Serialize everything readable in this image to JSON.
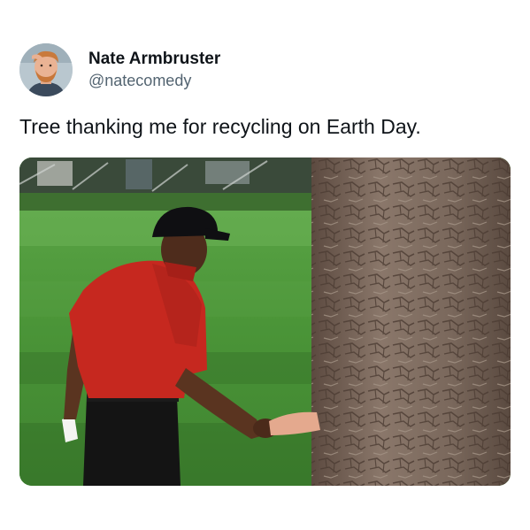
{
  "tweet": {
    "author": {
      "display_name": "Nate Armbruster",
      "handle": "@natecomedy",
      "avatar_icon": "avatar-photo"
    },
    "text": "Tree thanking me for recycling on Earth Day.",
    "media": {
      "kind": "photo",
      "icon": "photo-golfer-shaking-hand-with-tree"
    }
  },
  "colors": {
    "text_primary": "#0f1419",
    "text_secondary": "#536471",
    "background": "#ffffff",
    "grass": "#4f9a3e",
    "shirt": "#c6281f",
    "bark": "#7c6a5e"
  }
}
